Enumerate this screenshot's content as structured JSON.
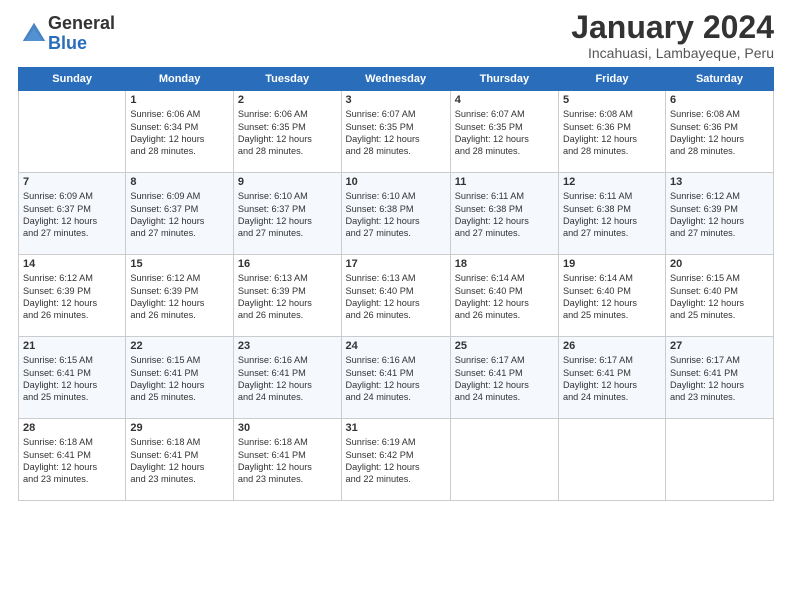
{
  "logo": {
    "general": "General",
    "blue": "Blue"
  },
  "title": "January 2024",
  "location": "Incahuasi, Lambayeque, Peru",
  "headers": [
    "Sunday",
    "Monday",
    "Tuesday",
    "Wednesday",
    "Thursday",
    "Friday",
    "Saturday"
  ],
  "weeks": [
    [
      {
        "day": "",
        "info": ""
      },
      {
        "day": "1",
        "info": "Sunrise: 6:06 AM\nSunset: 6:34 PM\nDaylight: 12 hours\nand 28 minutes."
      },
      {
        "day": "2",
        "info": "Sunrise: 6:06 AM\nSunset: 6:35 PM\nDaylight: 12 hours\nand 28 minutes."
      },
      {
        "day": "3",
        "info": "Sunrise: 6:07 AM\nSunset: 6:35 PM\nDaylight: 12 hours\nand 28 minutes."
      },
      {
        "day": "4",
        "info": "Sunrise: 6:07 AM\nSunset: 6:35 PM\nDaylight: 12 hours\nand 28 minutes."
      },
      {
        "day": "5",
        "info": "Sunrise: 6:08 AM\nSunset: 6:36 PM\nDaylight: 12 hours\nand 28 minutes."
      },
      {
        "day": "6",
        "info": "Sunrise: 6:08 AM\nSunset: 6:36 PM\nDaylight: 12 hours\nand 28 minutes."
      }
    ],
    [
      {
        "day": "7",
        "info": "Sunrise: 6:09 AM\nSunset: 6:37 PM\nDaylight: 12 hours\nand 27 minutes."
      },
      {
        "day": "8",
        "info": "Sunrise: 6:09 AM\nSunset: 6:37 PM\nDaylight: 12 hours\nand 27 minutes."
      },
      {
        "day": "9",
        "info": "Sunrise: 6:10 AM\nSunset: 6:37 PM\nDaylight: 12 hours\nand 27 minutes."
      },
      {
        "day": "10",
        "info": "Sunrise: 6:10 AM\nSunset: 6:38 PM\nDaylight: 12 hours\nand 27 minutes."
      },
      {
        "day": "11",
        "info": "Sunrise: 6:11 AM\nSunset: 6:38 PM\nDaylight: 12 hours\nand 27 minutes."
      },
      {
        "day": "12",
        "info": "Sunrise: 6:11 AM\nSunset: 6:38 PM\nDaylight: 12 hours\nand 27 minutes."
      },
      {
        "day": "13",
        "info": "Sunrise: 6:12 AM\nSunset: 6:39 PM\nDaylight: 12 hours\nand 27 minutes."
      }
    ],
    [
      {
        "day": "14",
        "info": "Sunrise: 6:12 AM\nSunset: 6:39 PM\nDaylight: 12 hours\nand 26 minutes."
      },
      {
        "day": "15",
        "info": "Sunrise: 6:12 AM\nSunset: 6:39 PM\nDaylight: 12 hours\nand 26 minutes."
      },
      {
        "day": "16",
        "info": "Sunrise: 6:13 AM\nSunset: 6:39 PM\nDaylight: 12 hours\nand 26 minutes."
      },
      {
        "day": "17",
        "info": "Sunrise: 6:13 AM\nSunset: 6:40 PM\nDaylight: 12 hours\nand 26 minutes."
      },
      {
        "day": "18",
        "info": "Sunrise: 6:14 AM\nSunset: 6:40 PM\nDaylight: 12 hours\nand 26 minutes."
      },
      {
        "day": "19",
        "info": "Sunrise: 6:14 AM\nSunset: 6:40 PM\nDaylight: 12 hours\nand 25 minutes."
      },
      {
        "day": "20",
        "info": "Sunrise: 6:15 AM\nSunset: 6:40 PM\nDaylight: 12 hours\nand 25 minutes."
      }
    ],
    [
      {
        "day": "21",
        "info": "Sunrise: 6:15 AM\nSunset: 6:41 PM\nDaylight: 12 hours\nand 25 minutes."
      },
      {
        "day": "22",
        "info": "Sunrise: 6:15 AM\nSunset: 6:41 PM\nDaylight: 12 hours\nand 25 minutes."
      },
      {
        "day": "23",
        "info": "Sunrise: 6:16 AM\nSunset: 6:41 PM\nDaylight: 12 hours\nand 24 minutes."
      },
      {
        "day": "24",
        "info": "Sunrise: 6:16 AM\nSunset: 6:41 PM\nDaylight: 12 hours\nand 24 minutes."
      },
      {
        "day": "25",
        "info": "Sunrise: 6:17 AM\nSunset: 6:41 PM\nDaylight: 12 hours\nand 24 minutes."
      },
      {
        "day": "26",
        "info": "Sunrise: 6:17 AM\nSunset: 6:41 PM\nDaylight: 12 hours\nand 24 minutes."
      },
      {
        "day": "27",
        "info": "Sunrise: 6:17 AM\nSunset: 6:41 PM\nDaylight: 12 hours\nand 23 minutes."
      }
    ],
    [
      {
        "day": "28",
        "info": "Sunrise: 6:18 AM\nSunset: 6:41 PM\nDaylight: 12 hours\nand 23 minutes."
      },
      {
        "day": "29",
        "info": "Sunrise: 6:18 AM\nSunset: 6:41 PM\nDaylight: 12 hours\nand 23 minutes."
      },
      {
        "day": "30",
        "info": "Sunrise: 6:18 AM\nSunset: 6:41 PM\nDaylight: 12 hours\nand 23 minutes."
      },
      {
        "day": "31",
        "info": "Sunrise: 6:19 AM\nSunset: 6:42 PM\nDaylight: 12 hours\nand 22 minutes."
      },
      {
        "day": "",
        "info": ""
      },
      {
        "day": "",
        "info": ""
      },
      {
        "day": "",
        "info": ""
      }
    ]
  ]
}
